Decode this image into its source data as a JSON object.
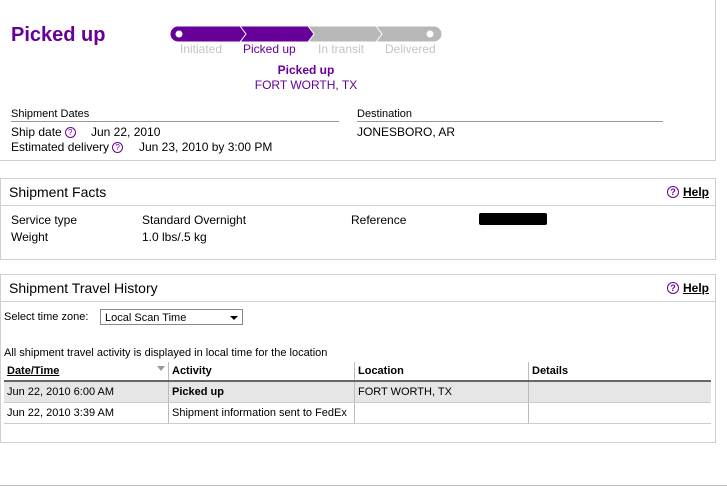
{
  "status": {
    "title": "Picked up"
  },
  "progress": {
    "steps": [
      "Initiated",
      "Picked up",
      "In transit",
      "Delivered"
    ],
    "completed_steps": 2,
    "active_color": "#660099",
    "inactive_color": "#b8b8b8",
    "current_status": "Picked up",
    "current_location": "FORT WORTH, TX"
  },
  "dates": {
    "heading": "Shipment Dates",
    "ship_label": "Ship date",
    "ship_value": "Jun 22, 2010",
    "delivery_label": "Estimated delivery",
    "delivery_value": "Jun 23, 2010 by 3:00 PM"
  },
  "destination": {
    "heading": "Destination",
    "value": "JONESBORO, AR"
  },
  "facts": {
    "title": "Shipment Facts",
    "help": "Help",
    "service_label": "Service type",
    "service_value": "Standard Overnight",
    "weight_label": "Weight",
    "weight_value": "1.0 lbs/.5 kg",
    "reference_label": "Reference"
  },
  "history": {
    "title": "Shipment Travel History",
    "help": "Help",
    "tz_label": "Select time zone:",
    "tz_value": "Local Scan Time",
    "note": "All shipment travel activity is displayed in local time for the location",
    "columns": [
      "Date/Time",
      "Activity",
      "Location",
      "Details"
    ],
    "rows": [
      {
        "datetime": "Jun 22, 2010 6:00 AM",
        "activity": "Picked up",
        "location": "FORT WORTH, TX",
        "details": ""
      },
      {
        "datetime": "Jun 22, 2010 3:39 AM",
        "activity": "Shipment information sent to FedEx",
        "location": "",
        "details": ""
      }
    ]
  }
}
